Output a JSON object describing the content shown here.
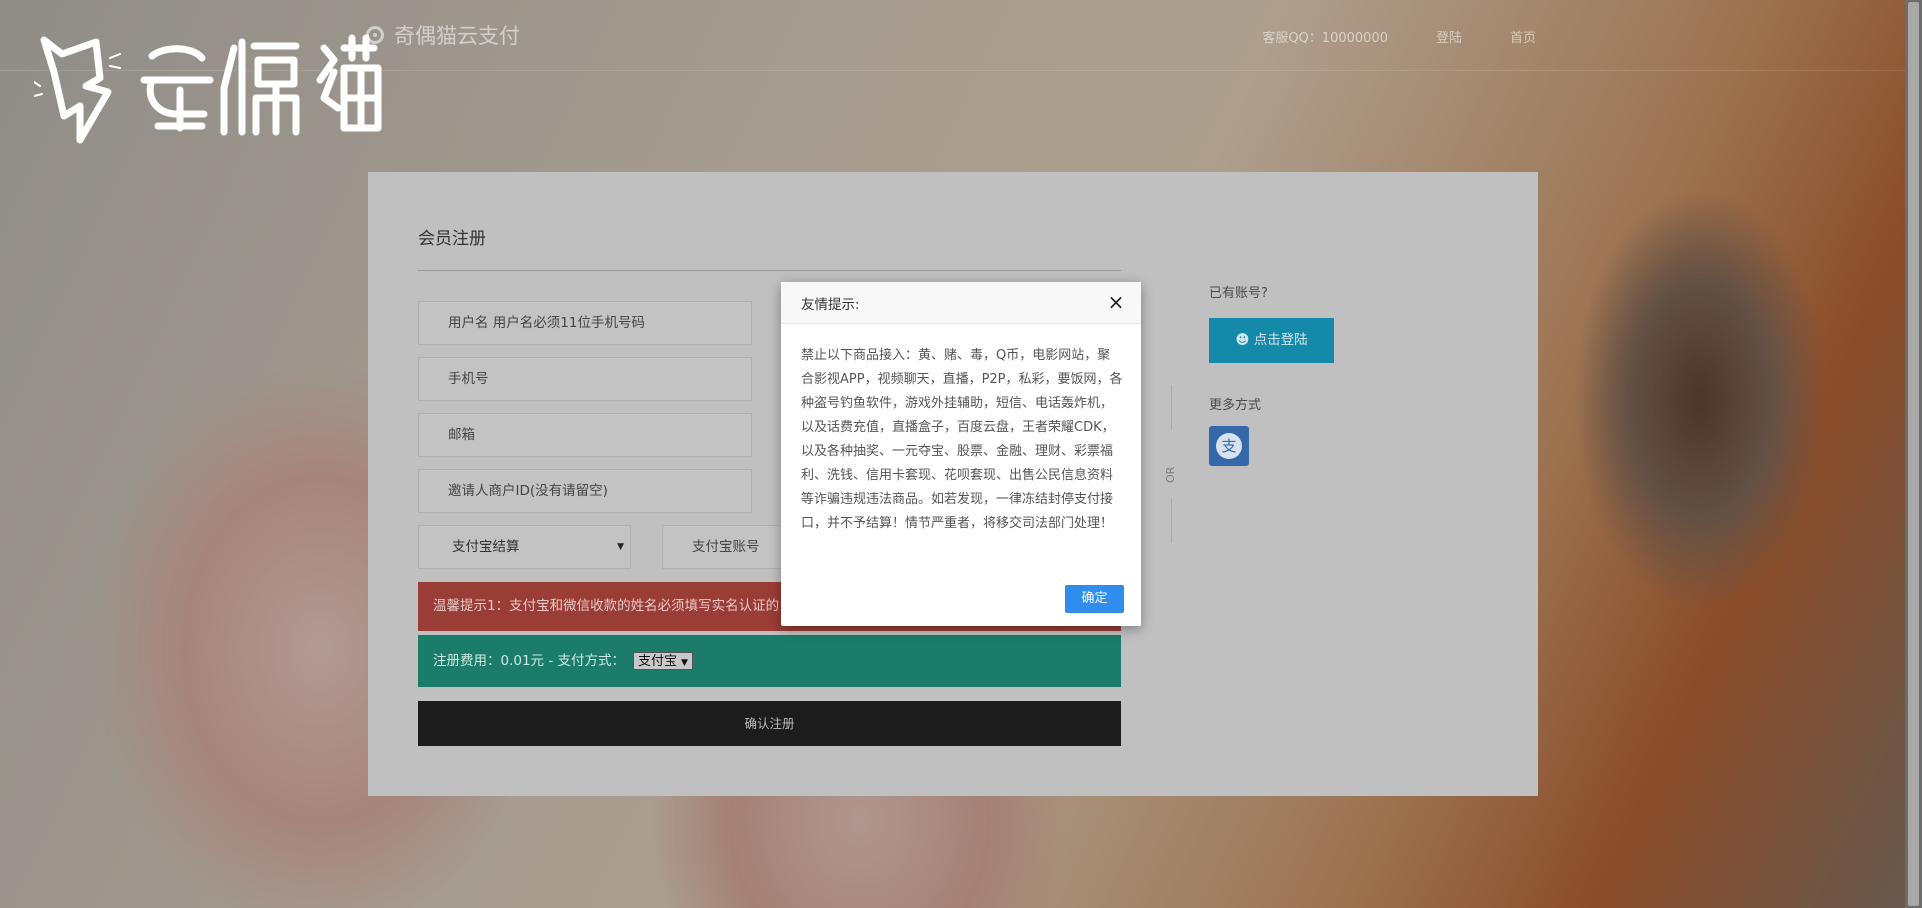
{
  "navbar": {
    "brand": "奇偶猫云支付",
    "links": [
      "客服QQ：10000000",
      "登陆",
      "首页"
    ]
  },
  "logo": {
    "text": "奇偶猫"
  },
  "register": {
    "title": "会员注册",
    "fields": {
      "username_placeholder": "用户名 用户名必须11位手机号码",
      "phone_placeholder": "手机号",
      "email_placeholder": "邮箱",
      "inviter_placeholder": "邀请人商户ID(没有请留空)"
    },
    "settlement_select": "支付宝结算",
    "alipay_account_placeholder": "支付宝账号",
    "alert_tip": "温馨提示1：支付宝和微信收款的姓名必须填写实名认证的",
    "fee_label": "注册费用：0.01元 - 支付方式：",
    "payment_method": "支付宝",
    "submit_label": "确认注册"
  },
  "sidebar": {
    "or_text": "OR",
    "have_account": "已有账号?",
    "login_button": "点击登陆",
    "more_methods": "更多方式",
    "alipay_glyph": "支"
  },
  "modal": {
    "title": "友情提示:",
    "body": "禁止以下商品接入：黄、赌、毒，Q币，电影网站，聚合影视APP，视频聊天，直播，P2P，私彩，要饭网，各种盗号钓鱼软件，游戏外挂辅助，短信、电话轰炸机，以及话费充值，直播盒子，百度云盘，王者荣耀CDK，以及各种抽奖、一元夺宝、股票、金融、理财、彩票福利、洗钱、信用卡套现、花呗套现、出售公民信息资料等诈骗违规违法商品。如若发现，一律冻结封停支付接口，并不予结算！情节严重者，将移交司法部门处理！",
    "ok_label": "确定"
  },
  "colors": {
    "accent_blue": "#2e8ded",
    "login_blue": "#1589a9",
    "alert_red": "#9a3d36",
    "alert_green": "#1b7d69"
  }
}
